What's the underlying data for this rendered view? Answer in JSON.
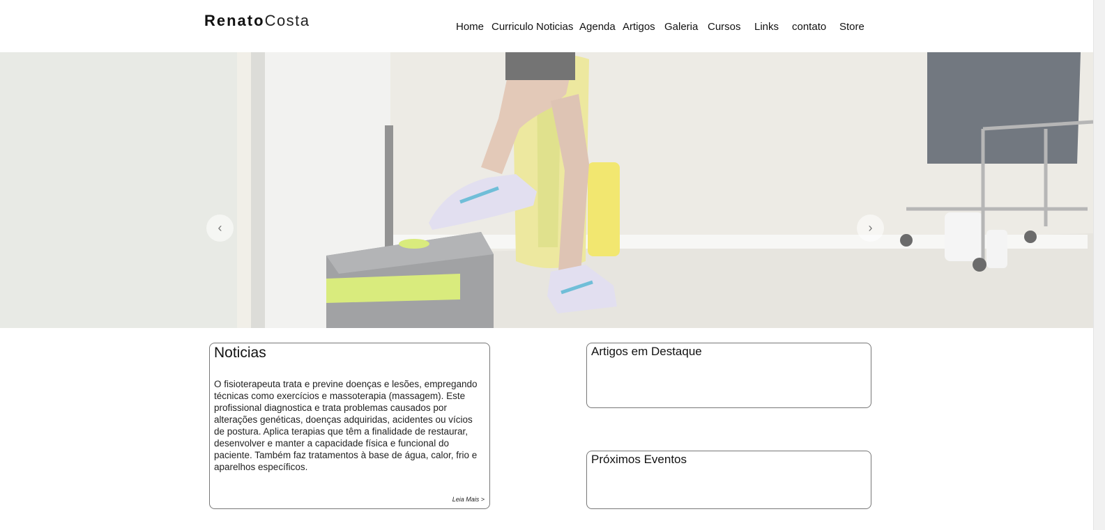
{
  "brand": {
    "bold": "Renato",
    "light": "Costa"
  },
  "nav": [
    "Home",
    "Curriculo",
    "Noticias",
    "Agenda",
    "Artigos",
    "Galeria",
    "Cursos",
    "Links",
    "contato",
    "Store"
  ],
  "slider": {
    "prev_icon": "chevron-left-icon",
    "next_icon": "chevron-right-icon",
    "prev_glyph": "‹",
    "next_glyph": "›"
  },
  "news": {
    "title": "Noticias",
    "body": "O fisioterapeuta trata e previne doenças e lesões, empregando técnicas como exercícios e massoterapia (massagem). Este profissional diagnostica e trata problemas causados por alterações genéticas, doenças adquiridas, acidentes ou vícios de postura. Aplica terapias que têm a finalidade de restaurar, desenvolver e manter a capacidade física e funcional do paciente. Também faz tratamentos à base de água, calor, frio e aparelhos específicos.",
    "read_more": "Leia Mais >"
  },
  "articles": {
    "title": "Artigos em Destaque"
  },
  "events": {
    "title": "Próximos Eventos"
  }
}
